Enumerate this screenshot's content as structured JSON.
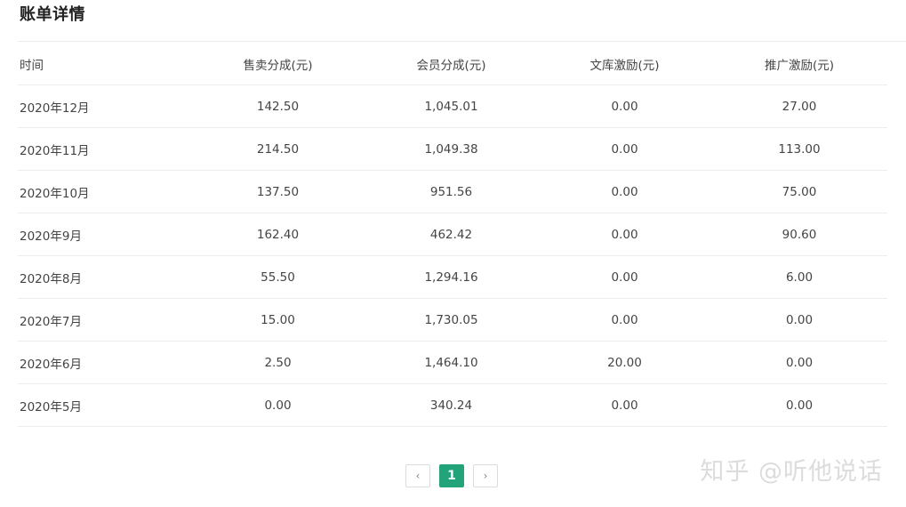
{
  "page": {
    "title": "账单详情"
  },
  "table": {
    "headers": [
      "时间",
      "售卖分成(元)",
      "会员分成(元)",
      "文库激励(元)",
      "推广激励(元)"
    ],
    "rows": [
      [
        "2020年12月",
        "142.50",
        "1,045.01",
        "0.00",
        "27.00"
      ],
      [
        "2020年11月",
        "214.50",
        "1,049.38",
        "0.00",
        "113.00"
      ],
      [
        "2020年10月",
        "137.50",
        "951.56",
        "0.00",
        "75.00"
      ],
      [
        "2020年9月",
        "162.40",
        "462.42",
        "0.00",
        "90.60"
      ],
      [
        "2020年8月",
        "55.50",
        "1,294.16",
        "0.00",
        "6.00"
      ],
      [
        "2020年7月",
        "15.00",
        "1,730.05",
        "0.00",
        "0.00"
      ],
      [
        "2020年6月",
        "2.50",
        "1,464.10",
        "20.00",
        "0.00"
      ],
      [
        "2020年5月",
        "0.00",
        "340.24",
        "0.00",
        "0.00"
      ]
    ]
  },
  "pagination": {
    "prev": "‹",
    "current": "1",
    "next": "›"
  },
  "watermark": "知乎 @听他说话",
  "colors": {
    "accent": "#22a37a",
    "divider": "#ececec"
  }
}
